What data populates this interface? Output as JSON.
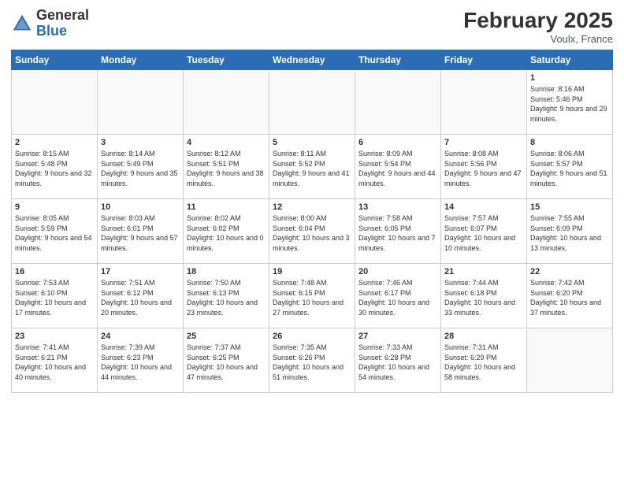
{
  "header": {
    "logo_general": "General",
    "logo_blue": "Blue",
    "month_title": "February 2025",
    "location": "Voulx, France"
  },
  "days_of_week": [
    "Sunday",
    "Monday",
    "Tuesday",
    "Wednesday",
    "Thursday",
    "Friday",
    "Saturday"
  ],
  "weeks": [
    [
      {
        "day": "",
        "info": ""
      },
      {
        "day": "",
        "info": ""
      },
      {
        "day": "",
        "info": ""
      },
      {
        "day": "",
        "info": ""
      },
      {
        "day": "",
        "info": ""
      },
      {
        "day": "",
        "info": ""
      },
      {
        "day": "1",
        "info": "Sunrise: 8:16 AM\nSunset: 5:46 PM\nDaylight: 9 hours and 29 minutes."
      }
    ],
    [
      {
        "day": "2",
        "info": "Sunrise: 8:15 AM\nSunset: 5:48 PM\nDaylight: 9 hours and 32 minutes."
      },
      {
        "day": "3",
        "info": "Sunrise: 8:14 AM\nSunset: 5:49 PM\nDaylight: 9 hours and 35 minutes."
      },
      {
        "day": "4",
        "info": "Sunrise: 8:12 AM\nSunset: 5:51 PM\nDaylight: 9 hours and 38 minutes."
      },
      {
        "day": "5",
        "info": "Sunrise: 8:11 AM\nSunset: 5:52 PM\nDaylight: 9 hours and 41 minutes."
      },
      {
        "day": "6",
        "info": "Sunrise: 8:09 AM\nSunset: 5:54 PM\nDaylight: 9 hours and 44 minutes."
      },
      {
        "day": "7",
        "info": "Sunrise: 8:08 AM\nSunset: 5:56 PM\nDaylight: 9 hours and 47 minutes."
      },
      {
        "day": "8",
        "info": "Sunrise: 8:06 AM\nSunset: 5:57 PM\nDaylight: 9 hours and 51 minutes."
      }
    ],
    [
      {
        "day": "9",
        "info": "Sunrise: 8:05 AM\nSunset: 5:59 PM\nDaylight: 9 hours and 54 minutes."
      },
      {
        "day": "10",
        "info": "Sunrise: 8:03 AM\nSunset: 6:01 PM\nDaylight: 9 hours and 57 minutes."
      },
      {
        "day": "11",
        "info": "Sunrise: 8:02 AM\nSunset: 6:02 PM\nDaylight: 10 hours and 0 minutes."
      },
      {
        "day": "12",
        "info": "Sunrise: 8:00 AM\nSunset: 6:04 PM\nDaylight: 10 hours and 3 minutes."
      },
      {
        "day": "13",
        "info": "Sunrise: 7:58 AM\nSunset: 6:05 PM\nDaylight: 10 hours and 7 minutes."
      },
      {
        "day": "14",
        "info": "Sunrise: 7:57 AM\nSunset: 6:07 PM\nDaylight: 10 hours and 10 minutes."
      },
      {
        "day": "15",
        "info": "Sunrise: 7:55 AM\nSunset: 6:09 PM\nDaylight: 10 hours and 13 minutes."
      }
    ],
    [
      {
        "day": "16",
        "info": "Sunrise: 7:53 AM\nSunset: 6:10 PM\nDaylight: 10 hours and 17 minutes."
      },
      {
        "day": "17",
        "info": "Sunrise: 7:51 AM\nSunset: 6:12 PM\nDaylight: 10 hours and 20 minutes."
      },
      {
        "day": "18",
        "info": "Sunrise: 7:50 AM\nSunset: 6:13 PM\nDaylight: 10 hours and 23 minutes."
      },
      {
        "day": "19",
        "info": "Sunrise: 7:48 AM\nSunset: 6:15 PM\nDaylight: 10 hours and 27 minutes."
      },
      {
        "day": "20",
        "info": "Sunrise: 7:46 AM\nSunset: 6:17 PM\nDaylight: 10 hours and 30 minutes."
      },
      {
        "day": "21",
        "info": "Sunrise: 7:44 AM\nSunset: 6:18 PM\nDaylight: 10 hours and 33 minutes."
      },
      {
        "day": "22",
        "info": "Sunrise: 7:42 AM\nSunset: 6:20 PM\nDaylight: 10 hours and 37 minutes."
      }
    ],
    [
      {
        "day": "23",
        "info": "Sunrise: 7:41 AM\nSunset: 6:21 PM\nDaylight: 10 hours and 40 minutes."
      },
      {
        "day": "24",
        "info": "Sunrise: 7:39 AM\nSunset: 6:23 PM\nDaylight: 10 hours and 44 minutes."
      },
      {
        "day": "25",
        "info": "Sunrise: 7:37 AM\nSunset: 6:25 PM\nDaylight: 10 hours and 47 minutes."
      },
      {
        "day": "26",
        "info": "Sunrise: 7:35 AM\nSunset: 6:26 PM\nDaylight: 10 hours and 51 minutes."
      },
      {
        "day": "27",
        "info": "Sunrise: 7:33 AM\nSunset: 6:28 PM\nDaylight: 10 hours and 54 minutes."
      },
      {
        "day": "28",
        "info": "Sunrise: 7:31 AM\nSunset: 6:29 PM\nDaylight: 10 hours and 58 minutes."
      },
      {
        "day": "",
        "info": ""
      }
    ]
  ]
}
